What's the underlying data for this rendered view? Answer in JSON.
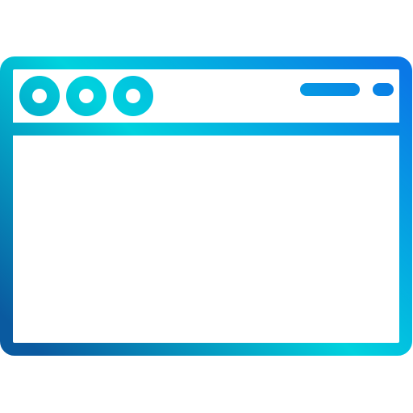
{
  "icon": {
    "name": "browser-window-icon",
    "style": "outline",
    "gradient": {
      "start": "#0a5aa0",
      "middle": "#00d2de",
      "end": "#0a78e6"
    },
    "background": "#ffffff"
  }
}
